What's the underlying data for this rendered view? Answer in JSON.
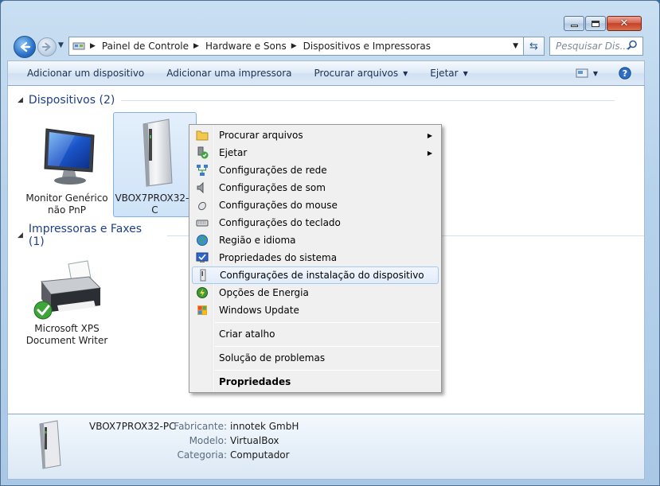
{
  "window": {
    "caption": {
      "min": "minimize",
      "max": "maximize",
      "close": "close"
    }
  },
  "address": {
    "crumbs": [
      "Painel de Controle",
      "Hardware e Sons",
      "Dispositivos e Impressoras"
    ]
  },
  "search": {
    "placeholder": "Pesquisar Dis..."
  },
  "toolbar": {
    "add_device": "Adicionar um dispositivo",
    "add_printer": "Adicionar uma impressora",
    "browse_files": "Procurar arquivos",
    "eject": "Ejetar"
  },
  "groups": {
    "devices": {
      "title": "Dispositivos (2)"
    },
    "printers": {
      "title": "Impressoras e Faxes (1)"
    }
  },
  "devices": [
    {
      "line1": "Monitor Genérico",
      "line2": "não PnP"
    },
    {
      "line1": "VBOX7PROX32-P",
      "line2": "C"
    }
  ],
  "printers": [
    {
      "line1": "Microsoft XPS",
      "line2": "Document Writer"
    }
  ],
  "context_menu": {
    "items": [
      {
        "label": "Procurar arquivos",
        "icon": "folder-icon",
        "submenu": true
      },
      {
        "label": "Ejetar",
        "icon": "eject-icon",
        "submenu": true
      },
      {
        "label": "Configurações de rede",
        "icon": "network-icon"
      },
      {
        "label": "Configurações de som",
        "icon": "speaker-icon"
      },
      {
        "label": "Configurações do mouse",
        "icon": "mouse-icon"
      },
      {
        "label": "Configurações do teclado",
        "icon": "keyboard-icon"
      },
      {
        "label": "Região e idioma",
        "icon": "globe-icon"
      },
      {
        "label": "Propriedades do sistema",
        "icon": "system-icon"
      },
      {
        "label": "Configurações de instalação do dispositivo",
        "icon": "device-icon",
        "highlighted": true
      },
      {
        "label": "Opções de Energia",
        "icon": "power-icon"
      },
      {
        "label": "Windows Update",
        "icon": "update-icon"
      },
      {
        "label": "Criar atalho"
      },
      {
        "label": "Solução de problemas"
      },
      {
        "label": "Propriedades",
        "bold": true
      }
    ]
  },
  "details": {
    "name": "VBOX7PROX32-PC",
    "manufacturer_label": "Fabricante:",
    "manufacturer": "innotek GmbH",
    "model_label": "Modelo:",
    "model": "VirtualBox",
    "category_label": "Categoria:",
    "category": "Computador"
  }
}
